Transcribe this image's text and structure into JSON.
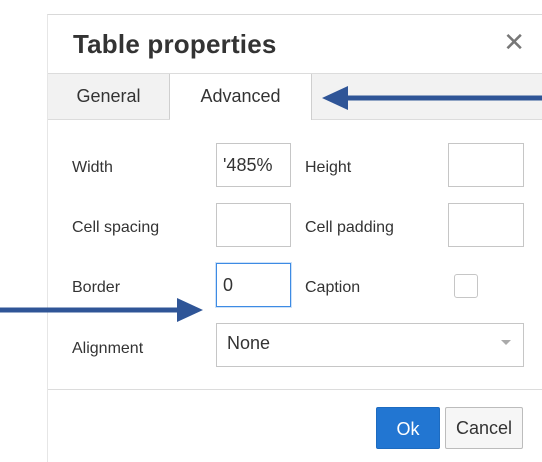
{
  "dialog": {
    "title": "Table properties",
    "close_icon": "close-icon"
  },
  "tabs": [
    {
      "label": "General"
    },
    {
      "label": "Advanced"
    }
  ],
  "form": {
    "width_label": "Width",
    "width_value": "'485%",
    "height_label": "Height",
    "height_value": "",
    "cell_spacing_label": "Cell spacing",
    "cell_spacing_value": "",
    "cell_padding_label": "Cell padding",
    "cell_padding_value": "",
    "border_label": "Border",
    "border_value": "0",
    "caption_label": "Caption",
    "caption_checked": false,
    "alignment_label": "Alignment",
    "alignment_value": "None"
  },
  "buttons": {
    "ok_label": "Ok",
    "cancel_label": "Cancel"
  },
  "colors": {
    "accent": "#2276d2",
    "annotation_arrow": "#2f5597",
    "focus_border": "#3d8be4"
  }
}
